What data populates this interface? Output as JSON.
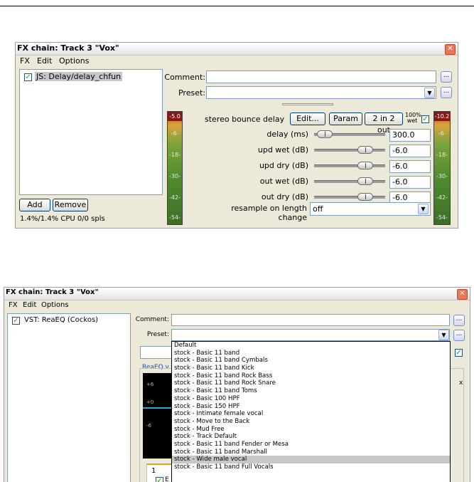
{
  "window1": {
    "title": "FX chain: Track 3 \"Vox\"",
    "close_glyph": "✕",
    "menu": [
      "FX",
      "Edit",
      "Options"
    ],
    "fx_item": "JS: Delay/delay_chfun",
    "add_label": "Add",
    "remove_label": "Remove",
    "cpu_status": "1.4%/1.4% CPU 0/0 spls",
    "comment_label": "Comment:",
    "preset_label": "Preset:",
    "dots": "...",
    "plugin_name": "stereo bounce delay",
    "edit_label": "Edit...",
    "param_label": "Param",
    "io_label": "2 in 2 out",
    "wet_label_top": "100%",
    "wet_label_bottom": "wet",
    "meter_left_peak": "-5.0",
    "meter_right_peak": "-10.2",
    "meter_ticks": [
      "-6-",
      "-18-",
      "-30-",
      "-42-",
      "-54-"
    ],
    "params": [
      {
        "label": "delay (ms)",
        "value": "300.0",
        "pos": 0.05
      },
      {
        "label": "upd wet (dB)",
        "value": "-6.0",
        "pos": 0.78
      },
      {
        "label": "upd dry (dB)",
        "value": "-6.0",
        "pos": 0.78
      },
      {
        "label": "out wet (dB)",
        "value": "-6.0",
        "pos": 0.78
      },
      {
        "label": "out dry (dB)",
        "value": "-6.0",
        "pos": 0.78
      }
    ],
    "resample_label": "resample on length change",
    "resample_value": "off"
  },
  "window2": {
    "title": "FX chain: Track 3 \"Vox\"",
    "close_glyph": "✕",
    "menu": [
      "FX",
      "Edit",
      "Options"
    ],
    "fx_item": "VST: ReaEQ (Cockos)",
    "comment_label": "Comment:",
    "preset_label": "Preset:",
    "dots": "...",
    "reaeq_fragment": "ReaEQ v",
    "right_fragment": "x",
    "band_tab": "1",
    "enable_fragment": "E",
    "graph_labels": [
      "+6",
      "+0",
      "-6"
    ],
    "preset_options": [
      "Default",
      "stock - Basic 11 band",
      "stock - Basic 11 band Cymbals",
      "stock - Basic 11 band Kick",
      "stock - Basic 11 band Rock Bass",
      "stock - Basic 11 band Rock Snare",
      "stock - Basic 11 band Toms",
      "stock - Basic 100 HPF",
      "stock - Basic 150 HPF",
      "stock - Intimate female vocal",
      "stock - Move to the Back",
      "stock - Mud Free",
      "stock - Track Default",
      "stock - Basic 11 band Fender or Mesa",
      "stock - Basic 11 band Marshall",
      "stock - Wide male vocal",
      "stock - Basic 11 band Full Vocals"
    ],
    "highlighted_index": 15
  },
  "colors": {
    "window_bg": "#ece9d8",
    "selection": "#c7c7c7",
    "checkmark": "#21a121",
    "close": "#e9765c"
  }
}
